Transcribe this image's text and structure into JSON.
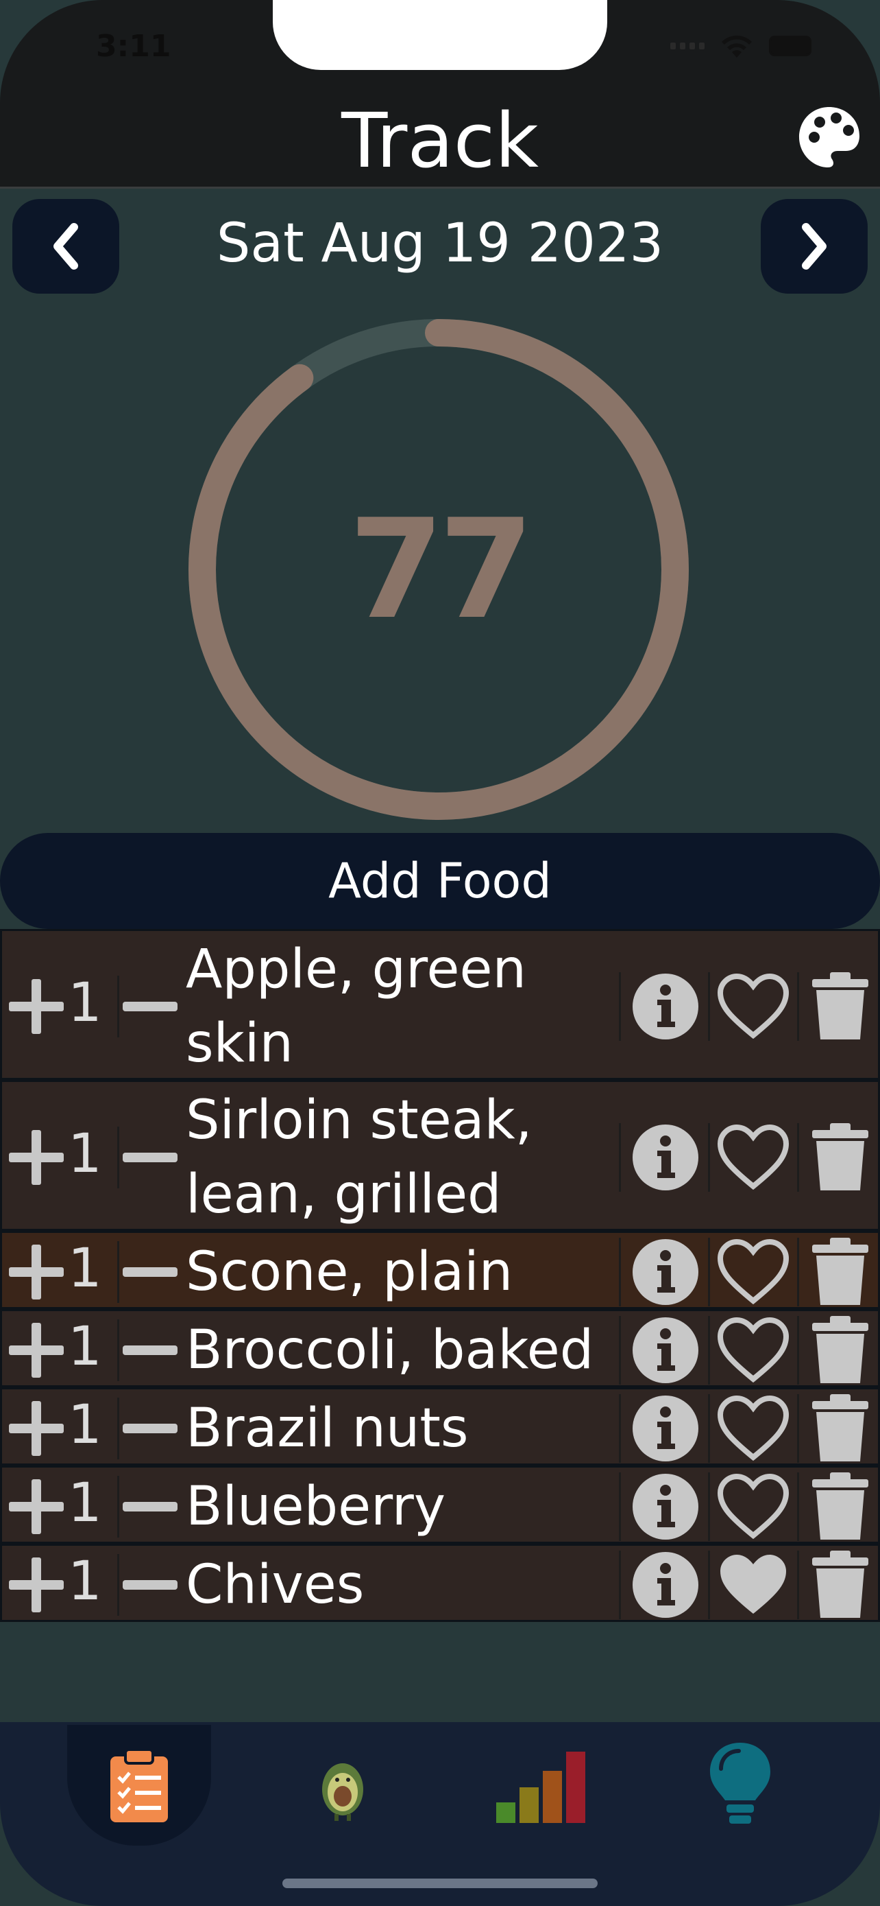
{
  "status": {
    "time": "3:11"
  },
  "header": {
    "title": "Track"
  },
  "date_nav": {
    "date": "Sat Aug 19 2023"
  },
  "score": {
    "value": "77",
    "progress_fraction": 0.9
  },
  "add_food": {
    "label": "Add Food"
  },
  "foods": [
    {
      "qty_label": "1",
      "name": "Apple, green skin",
      "favorite": false
    },
    {
      "qty_label": "1",
      "name": "Sirloin steak, lean, grilled",
      "favorite": false
    },
    {
      "qty_label": "1",
      "name": "Scone, plain",
      "favorite": false
    },
    {
      "qty_label": "1",
      "name": "Broccoli, baked",
      "favorite": false
    },
    {
      "qty_label": "1",
      "name": "Brazil nuts",
      "favorite": false
    },
    {
      "qty_label": "1",
      "name": "Blueberry",
      "favorite": false
    },
    {
      "qty_label": "1",
      "name": "Chives",
      "favorite": true
    }
  ],
  "icons": {
    "palette": "palette-icon",
    "prev": "chevron-left-icon",
    "next": "chevron-right-icon",
    "plus": "plus-icon",
    "minus": "minus-icon",
    "info": "info-icon",
    "heart": "heart-icon",
    "trash": "trash-icon"
  },
  "tabs": [
    {
      "icon": "clipboard-icon",
      "active": true
    },
    {
      "icon": "avocado-icon",
      "active": false
    },
    {
      "icon": "bar-chart-icon",
      "active": false
    },
    {
      "icon": "lightbulb-icon",
      "active": false
    }
  ],
  "colors": {
    "background": "#27393a",
    "header": "#181a1b",
    "button_dark": "#0c1628",
    "ring": "#8a7468",
    "row": "#2f2522",
    "row_highlight": "#3a2519",
    "tab_bar": "#152034"
  }
}
